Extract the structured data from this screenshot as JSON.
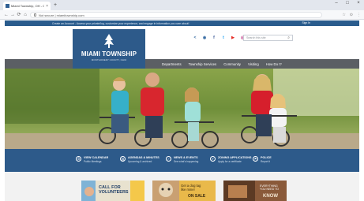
{
  "browser": {
    "tab_title": "Miami Township, OH - Official",
    "tab_close": "×",
    "new_tab": "+",
    "url": "Not secure | miamitownship.com",
    "controls": [
      "–",
      "□",
      "×"
    ],
    "nav_buttons": [
      "←",
      "→",
      "⟳",
      "⌂"
    ],
    "right_icons": [
      "☆",
      "⊙",
      "⋮"
    ]
  },
  "topstrip": {
    "text": "Create an Account - Access your private/log, customize your experience, and engage in information you care about!",
    "signin": "Sign In"
  },
  "logo": {
    "name": "MIAMI TOWNSHIP",
    "sub": "MONTGOMERY COUNTY, OHIO"
  },
  "social": [
    {
      "icon": "share-icon",
      "glyph": "<",
      "color": "#3b6ea5"
    },
    {
      "icon": "rss-icon",
      "glyph": "◉",
      "color": "#3b6ea5"
    },
    {
      "icon": "facebook-icon",
      "glyph": "f",
      "color": "#3b5998"
    },
    {
      "icon": "twitter-icon",
      "glyph": "t",
      "color": "#1da1f2"
    },
    {
      "icon": "youtube-icon",
      "glyph": "▶",
      "color": "#e52d27"
    },
    {
      "icon": "instagram-icon",
      "glyph": "◎",
      "color": "#c13584"
    }
  ],
  "search": {
    "placeholder": "Search this site",
    "icon": "⌕"
  },
  "nav": [
    "Departments",
    "Township Services",
    "Community",
    "Visiting",
    "How Do I?"
  ],
  "quicklinks": [
    {
      "title": "VIEW CALENDAR",
      "sub": "Public Meetings",
      "icon": "⏱"
    },
    {
      "title": "AGENDAS & MINUTES",
      "sub": "Upcoming & archived",
      "icon": "▤"
    },
    {
      "title": "NEWS & EVENTS",
      "sub": "See what's happening",
      "icon": "✓"
    },
    {
      "title": "ZONING APPLICATIONS",
      "sub": "Apply for a certificate",
      "icon": "✔"
    },
    {
      "title": "POLICE",
      "sub": "Report it",
      "icon": "⚑"
    }
  ],
  "cards": {
    "card1_text": [
      "CALL FOR",
      "VOLUNTEERS"
    ],
    "card2_text": [
      "Get a dog tag",
      "like mine!"
    ],
    "card2_big": "ON SALE",
    "card3_text": [
      "EVERYTHING",
      "YOU NEED TO"
    ],
    "card3_big": "KNOW"
  },
  "colors": {
    "brand_blue": "#2d5a8a",
    "nav_gray": "#5b5f64",
    "strip_blue": "#2a5c8d"
  }
}
